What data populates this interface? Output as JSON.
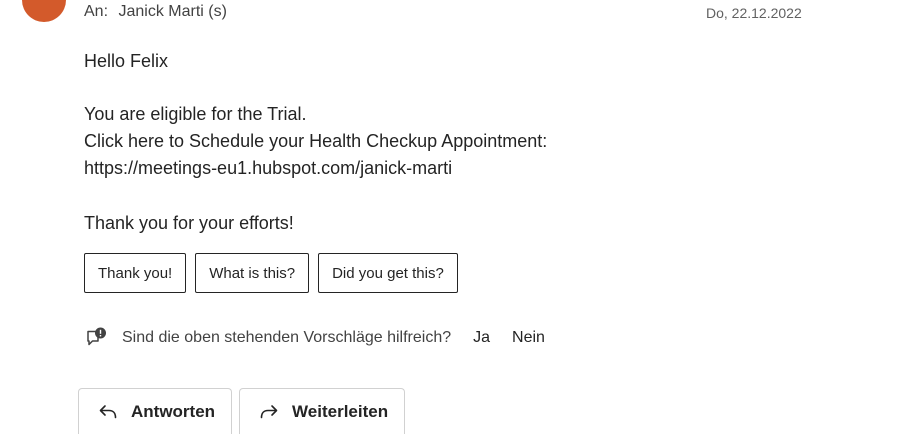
{
  "header": {
    "to_prefix": "An:",
    "recipient": "Janick Marti (s)",
    "date": "Do, 22.12.2022"
  },
  "message": {
    "greeting": "Hello Felix",
    "lines": [
      "You are eligible for the Trial.",
      "Click here to Schedule your Health Checkup Appointment:",
      "https://meetings-eu1.hubspot.com/janick-marti"
    ],
    "closing": "Thank you for your efforts!"
  },
  "suggested_replies": [
    "Thank you!",
    "What is this?",
    "Did you get this?"
  ],
  "feedback": {
    "question": "Sind die oben stehenden Vorschläge hilfreich?",
    "yes": "Ja",
    "no": "Nein",
    "icon": "feedback-icon"
  },
  "actions": {
    "reply": {
      "label": "Antworten",
      "icon": "reply-icon"
    },
    "forward": {
      "label": "Weiterleiten",
      "icon": "forward-icon"
    }
  },
  "colors": {
    "avatar": "#d35a2b",
    "text": "#242424",
    "muted": "#616161"
  }
}
